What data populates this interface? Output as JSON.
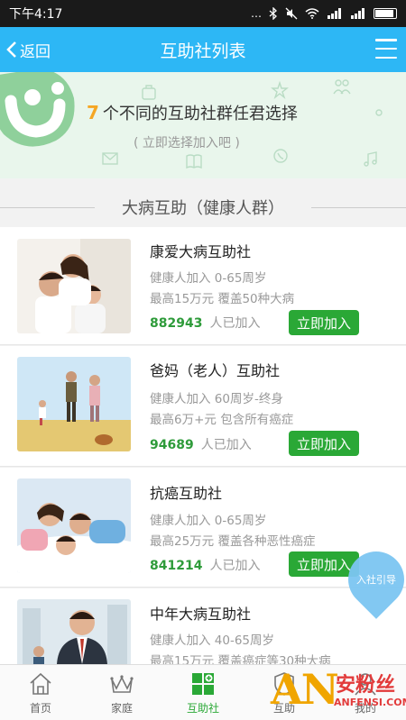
{
  "status_bar": {
    "time": "下午4:17",
    "dots": "…",
    "signal": "4G"
  },
  "nav": {
    "back_label": "返回",
    "title": "互助社列表"
  },
  "banner": {
    "count": "7",
    "headline": "个不同的互助社群任君选择",
    "subline": "( 立即选择加入吧 )"
  },
  "section": {
    "title": "大病互助（健康人群）"
  },
  "cards": [
    {
      "name": "康爱大病互助社",
      "line1": "健康人加入 0-65周岁",
      "line2": "最高15万元 覆盖50种大病",
      "count": "882943",
      "count_suffix": "人已加入",
      "button": "立即加入"
    },
    {
      "name": "爸妈（老人）互助社",
      "line1": "健康人加入 60周岁-终身",
      "line2": "最高6万+元 包含所有癌症",
      "count": "94689",
      "count_suffix": "人已加入",
      "button": "立即加入"
    },
    {
      "name": "抗癌互助社",
      "line1": "健康人加入 0-65周岁",
      "line2": "最高25万元 覆盖各种恶性癌症",
      "count": "841214",
      "count_suffix": "人已加入",
      "button": "立即加入"
    },
    {
      "name": "中年大病互助社",
      "line1": "健康人加入 40-65周岁",
      "line2": "最高15万元 覆盖癌症等30种大病",
      "count": "",
      "count_suffix": "",
      "button": ""
    }
  ],
  "guide_bubble": "入社引导",
  "tabs": [
    {
      "label": "首页",
      "icon": "home-icon"
    },
    {
      "label": "家庭",
      "icon": "crown-icon"
    },
    {
      "label": "互助社",
      "icon": "grid-plus-icon"
    },
    {
      "label": "互助",
      "icon": "shield-icon"
    },
    {
      "label": "我的",
      "icon": "person-icon"
    }
  ],
  "watermark": {
    "an": "AN",
    "cn": "安粉丝",
    "url": "ANFENSI.COM"
  },
  "colors": {
    "primary": "#2db7f5",
    "accent": "#2aa836",
    "highlight": "#f5a623"
  }
}
